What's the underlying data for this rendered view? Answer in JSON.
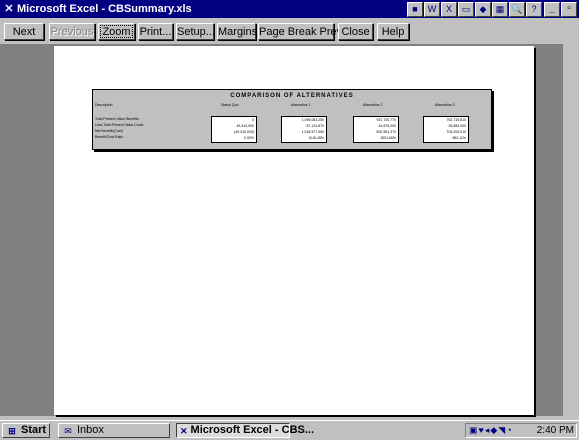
{
  "window": {
    "title": "Microsoft Excel - CBSummary.xls"
  },
  "toolbar": {
    "next": "Next",
    "previous": "Previous",
    "zoom": "Zoom",
    "print": "Print...",
    "setup": "Setup...",
    "margins": "Margins",
    "page_break_preview": "Page Break Preview",
    "close": "Close",
    "help": "Help"
  },
  "sheet": {
    "title": "COMPARISON OF ALTERNATIVES",
    "headers": [
      "Description",
      "Status Quo",
      "Alternative 1",
      "Alternative 2",
      "Alternative 3"
    ],
    "row_labels": [
      "Total Present Value Benefits",
      "Less Total Present Value Costs",
      "Net Benefit/(Cost)",
      "Benefit/Cost Ratio"
    ],
    "columns": [
      [
        "0",
        "49,410,000",
        "(49,410,000)",
        "0.00%"
      ],
      [
        "1,095,083,250",
        "87,124,870",
        "1,016,977,950",
        "1015.45%"
      ],
      [
        "937,730,770",
        "44,875,000",
        "892,551,370",
        "1591.66%"
      ],
      [
        "762,715,810",
        "93,865,000",
        "703,205,010",
        "852.11%"
      ]
    ]
  },
  "taskbar": {
    "start": "Start",
    "inbox": "Inbox",
    "excel": "Microsoft Excel - CBS...",
    "clock": "2:40 PM"
  }
}
